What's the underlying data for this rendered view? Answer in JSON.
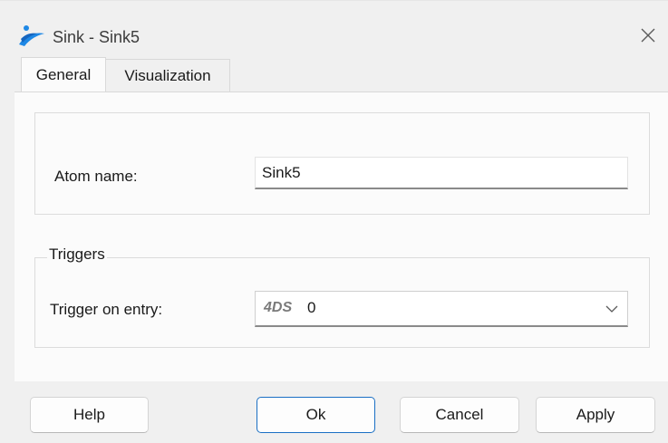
{
  "window": {
    "title": "Sink - Sink5",
    "app_icon": "app-logo-icon",
    "close_icon": "close-icon"
  },
  "tabs": [
    {
      "label": "General",
      "active": true
    },
    {
      "label": "Visualization",
      "active": false
    }
  ],
  "general": {
    "atom_name_label": "Atom name:",
    "atom_name_value": "Sink5",
    "triggers_group_label": "Triggers",
    "trigger_entry_label": "Trigger on entry:",
    "trigger_entry_prefix": "4DS",
    "trigger_entry_value": "0"
  },
  "buttons": {
    "help": "Help",
    "ok": "Ok",
    "cancel": "Cancel",
    "apply": "Apply"
  },
  "colors": {
    "accent": "#1a6fc4",
    "logo_blue": "#1e88e5"
  }
}
